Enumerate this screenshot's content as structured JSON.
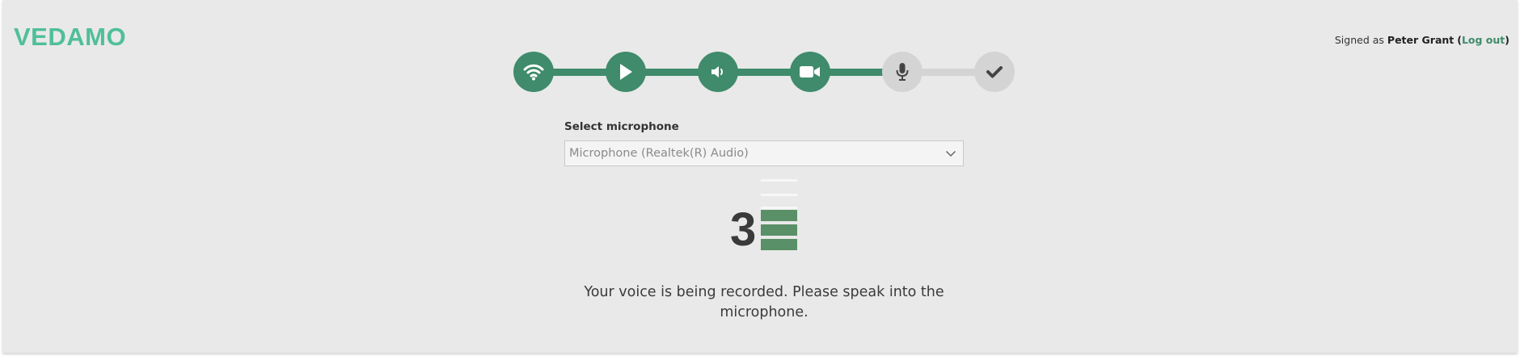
{
  "header": {
    "logo_text": "VEDAMO",
    "signed_prefix": "Signed as",
    "user_name": "Peter Grant",
    "open_paren": "(",
    "logout_label": "Log out",
    "close_paren": ")"
  },
  "stepper": {
    "steps": [
      {
        "icon": "wifi-icon",
        "state": "done"
      },
      {
        "icon": "play-icon",
        "state": "done"
      },
      {
        "icon": "speaker-icon",
        "state": "done"
      },
      {
        "icon": "video-camera-icon",
        "state": "done"
      },
      {
        "icon": "microphone-icon",
        "state": "current"
      },
      {
        "icon": "check-icon",
        "state": "todo"
      }
    ],
    "colors": {
      "done": "#3f8b6c",
      "todo": "#d4d4d4",
      "todo_icon": "#444444"
    }
  },
  "microphone": {
    "label": "Select microphone",
    "selected": "Microphone (Realtek(R) Audio)"
  },
  "level": {
    "countdown": "3",
    "total_bars": 6,
    "filled_bars": 3,
    "fill_color": "#5a9067"
  },
  "message": "Your voice is being recorded. Please speak into the microphone."
}
